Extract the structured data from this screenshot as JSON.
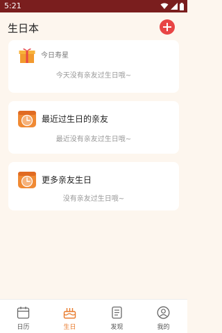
{
  "status_bar": {
    "time": "5:21"
  },
  "header": {
    "title": "生日本"
  },
  "cards": [
    {
      "label": "今日寿星",
      "empty_text": "今天没有亲友过生日哦~"
    },
    {
      "label": "最近过生日的亲友",
      "empty_text": "最近没有亲友过生日哦~"
    },
    {
      "label": "更多亲友生日",
      "empty_text": "没有亲友过生日哦~"
    }
  ],
  "tabs": [
    {
      "label": "日历"
    },
    {
      "label": "生日"
    },
    {
      "label": "发现"
    },
    {
      "label": "我的"
    }
  ],
  "colors": {
    "accent": "#E8792A",
    "add_button": "#E84545",
    "status_bar": "#7A1E1E",
    "background": "#FDF6EE"
  },
  "active_tab": "生日"
}
